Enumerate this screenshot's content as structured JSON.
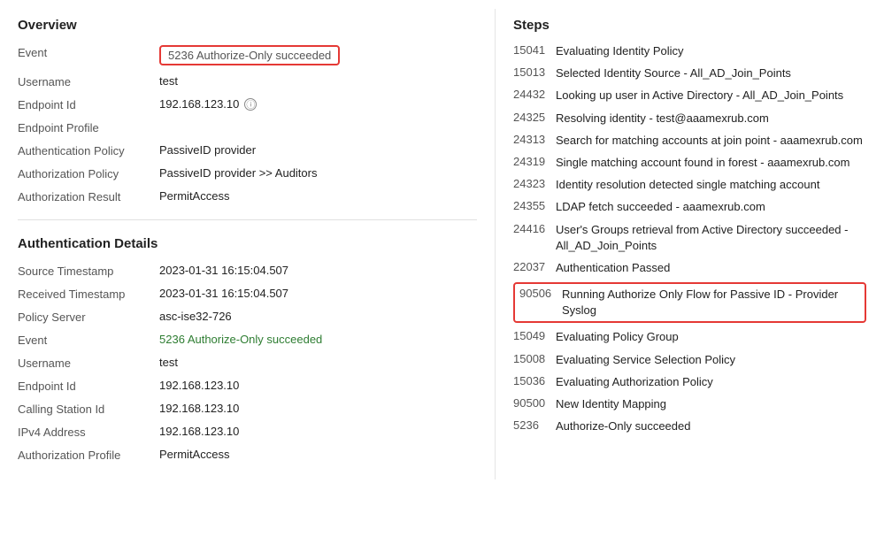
{
  "left": {
    "overview_title": "Overview",
    "fields": [
      {
        "label": "Event",
        "value": "5236 Authorize-Only succeeded",
        "type": "badge"
      },
      {
        "label": "Username",
        "value": "test",
        "type": "text"
      },
      {
        "label": "Endpoint Id",
        "value": "192.168.123.10",
        "type": "endpoint"
      },
      {
        "label": "Endpoint Profile",
        "value": "",
        "type": "text"
      },
      {
        "label": "Authentication Policy",
        "value": "PassiveID provider",
        "type": "text"
      },
      {
        "label": "Authorization Policy",
        "value": "PassiveID provider >> Auditors",
        "type": "text"
      },
      {
        "label": "Authorization Result",
        "value": "PermitAccess",
        "type": "text"
      }
    ],
    "auth_details_title": "Authentication Details",
    "auth_fields": [
      {
        "label": "Source Timestamp",
        "value": "2023-01-31 16:15:04.507",
        "type": "text"
      },
      {
        "label": "Received Timestamp",
        "value": "2023-01-31 16:15:04.507",
        "type": "text"
      },
      {
        "label": "Policy Server",
        "value": "asc-ise32-726",
        "type": "text"
      },
      {
        "label": "Event",
        "value": "5236 Authorize-Only succeeded",
        "type": "green"
      },
      {
        "label": "Username",
        "value": "test",
        "type": "text"
      },
      {
        "label": "Endpoint Id",
        "value": "192.168.123.10",
        "type": "text"
      },
      {
        "label": "Calling Station Id",
        "value": "192.168.123.10",
        "type": "text"
      },
      {
        "label": "IPv4 Address",
        "value": "192.168.123.10",
        "type": "text"
      },
      {
        "label": "Authorization Profile",
        "value": "PermitAccess",
        "type": "text"
      }
    ]
  },
  "right": {
    "steps_title": "Steps",
    "steps": [
      {
        "code": "15041",
        "desc": "Evaluating Identity Policy",
        "highlighted": false
      },
      {
        "code": "15013",
        "desc": "Selected Identity Source - All_AD_Join_Points",
        "highlighted": false
      },
      {
        "code": "24432",
        "desc": "Looking up user in Active Directory - All_AD_Join_Points",
        "highlighted": false
      },
      {
        "code": "24325",
        "desc": "Resolving identity - test@aaamexrub.com",
        "highlighted": false
      },
      {
        "code": "24313",
        "desc": "Search for matching accounts at join point - aaamexrub.com",
        "highlighted": false
      },
      {
        "code": "24319",
        "desc": "Single matching account found in forest - aaamexrub.com",
        "highlighted": false
      },
      {
        "code": "24323",
        "desc": "Identity resolution detected single matching account",
        "highlighted": false
      },
      {
        "code": "24355",
        "desc": "LDAP fetch succeeded - aaamexrub.com",
        "highlighted": false
      },
      {
        "code": "24416",
        "desc": "User's Groups retrieval from Active Directory succeeded - All_AD_Join_Points",
        "highlighted": false
      },
      {
        "code": "22037",
        "desc": "Authentication Passed",
        "highlighted": false
      },
      {
        "code": "90506",
        "desc": "Running Authorize Only Flow for Passive ID - Provider Syslog",
        "highlighted": true
      },
      {
        "code": "15049",
        "desc": "Evaluating Policy Group",
        "highlighted": false
      },
      {
        "code": "15008",
        "desc": "Evaluating Service Selection Policy",
        "highlighted": false
      },
      {
        "code": "15036",
        "desc": "Evaluating Authorization Policy",
        "highlighted": false
      },
      {
        "code": "90500",
        "desc": "New Identity Mapping",
        "highlighted": false
      },
      {
        "code": "5236",
        "desc": "Authorize-Only succeeded",
        "highlighted": false
      }
    ]
  }
}
